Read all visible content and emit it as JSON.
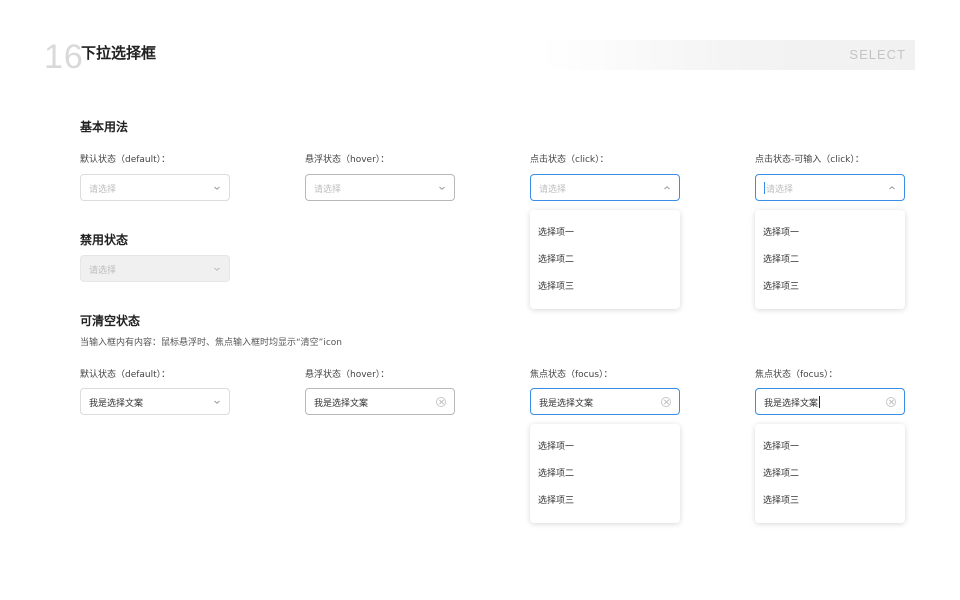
{
  "header": {
    "page_number": "16",
    "title": "下拉选择框",
    "title_en": "SELECT"
  },
  "sections": {
    "basic": {
      "title": "基本用法"
    },
    "disabled": {
      "title": "禁用状态"
    },
    "clearable": {
      "title": "可清空状态",
      "description": "当输入框内有内容：鼠标悬浮时、焦点输入框时均显示“清空”icon"
    }
  },
  "basic": {
    "default": {
      "label": "默认状态（default）：",
      "placeholder": "请选择"
    },
    "hover": {
      "label": "悬浮状态（hover）：",
      "placeholder": "请选择"
    },
    "click": {
      "label": "点击状态（click）：",
      "placeholder": "请选择",
      "options": [
        "选择项一",
        "选择项二",
        "选择项三"
      ]
    },
    "click_input": {
      "label": "点击状态-可输入（click）：",
      "placeholder": "请选择",
      "options": [
        "选择项一",
        "选择项二",
        "选择项三"
      ]
    }
  },
  "disabled": {
    "placeholder": "请选择"
  },
  "clearable": {
    "default": {
      "label": "默认状态（default）：",
      "value": "我是选择文案"
    },
    "hover": {
      "label": "悬浮状态（hover）：",
      "value": "我是选择文案"
    },
    "focus": {
      "label": "焦点状态（focus）：",
      "value": "我是选择文案",
      "options": [
        "选择项一",
        "选择项二",
        "选择项三"
      ]
    },
    "focus_input": {
      "label": "焦点状态（focus）：",
      "value": "我是选择文案",
      "options": [
        "选择项一",
        "选择项二",
        "选择项三"
      ]
    }
  },
  "colors": {
    "accent": "#3a8ee6",
    "border": "#dcdcdc",
    "placeholder": "#bdbdbd",
    "disabled_bg": "#f0f0f0"
  },
  "icons": {
    "arrow_down": "chevron-down-icon",
    "arrow_up": "chevron-up-icon",
    "clear": "clear-circle-icon"
  }
}
